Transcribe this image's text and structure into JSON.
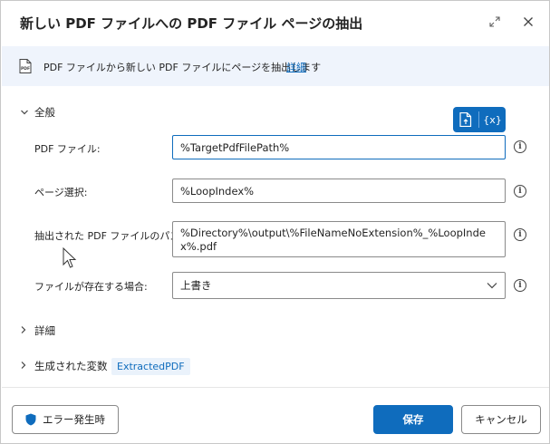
{
  "dialog": {
    "title": "新しい PDF ファイルへの PDF ファイル ページの抽出",
    "info_text": "PDF ファイルから新しい PDF ファイルにページを抽出します",
    "info_link": "詳細"
  },
  "general": {
    "label": "全般",
    "fields": [
      {
        "label": "PDF ファイル:",
        "value": "%TargetPdfFilePath%"
      },
      {
        "label": "ページ選択:",
        "value": "%LoopIndex%"
      },
      {
        "label": "抽出された PDF ファイルのパス:",
        "value": "%Directory%\\output\\%FileNameNoExtension%_%LoopIndex%.pdf"
      },
      {
        "label": "ファイルが存在する場合:",
        "value": "上書き"
      }
    ]
  },
  "var_picker": {
    "label": "{x}"
  },
  "advanced": {
    "label": "詳細"
  },
  "variables": {
    "label": "生成された変数",
    "badge": "ExtractedPDF"
  },
  "footer": {
    "error_button": "エラー発生時",
    "save_button": "保存",
    "cancel_button": "キャンセル"
  },
  "colors": {
    "accent": "#0f6cbd",
    "info_bg": "#eff4fc"
  }
}
